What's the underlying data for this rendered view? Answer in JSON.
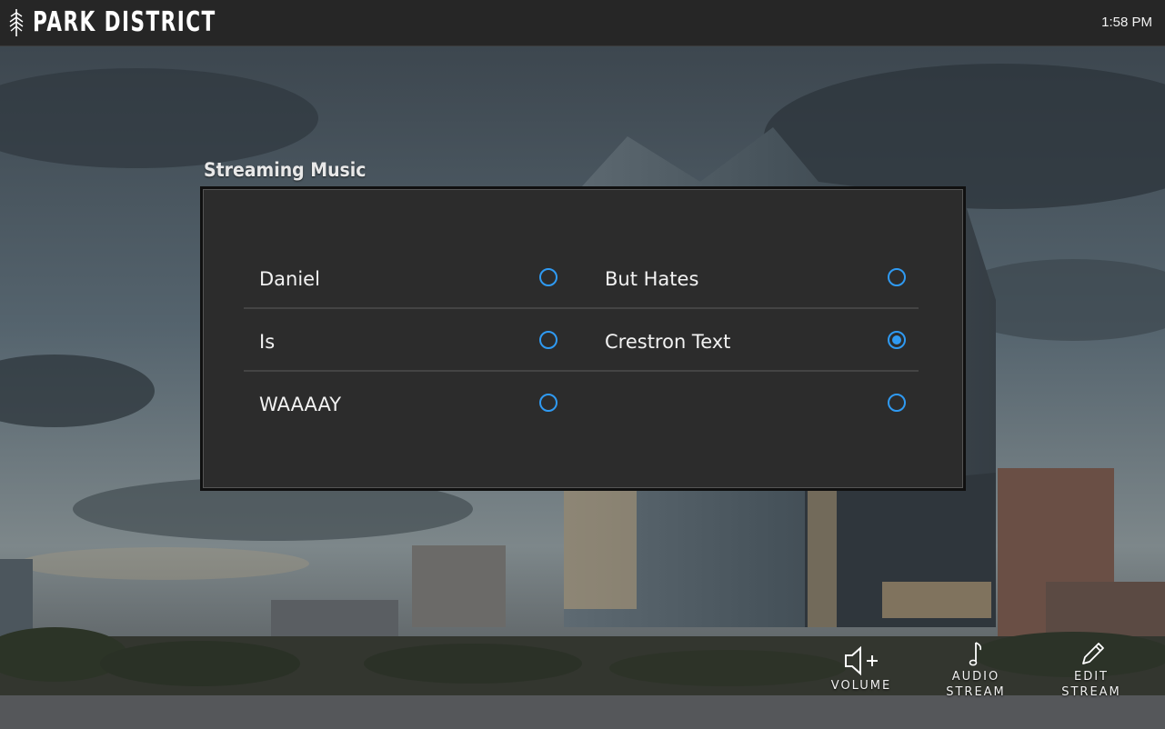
{
  "header": {
    "brand": "PARK DISTRICT",
    "clock": "1:58 PM"
  },
  "panel": {
    "title": "Streaming Music",
    "options": [
      {
        "label": "Daniel",
        "selected": false
      },
      {
        "label": "But Hates",
        "selected": false
      },
      {
        "label": "Is",
        "selected": false
      },
      {
        "label": "Crestron Text",
        "selected": true
      },
      {
        "label": "WAAAAY",
        "selected": false
      },
      {
        "label": "",
        "selected": false
      }
    ]
  },
  "controls": {
    "volume": {
      "label": "VOLUME",
      "icon": "speaker-plus-icon"
    },
    "audio_stream": {
      "label": "AUDIO\nSTREAM",
      "icon": "music-note-icon"
    },
    "edit_stream": {
      "label": "EDIT\nSTREAM",
      "icon": "pencil-icon"
    }
  },
  "colors": {
    "accent": "#2f9af2",
    "panel": "#2c2c2c",
    "topbar": "#262626"
  }
}
